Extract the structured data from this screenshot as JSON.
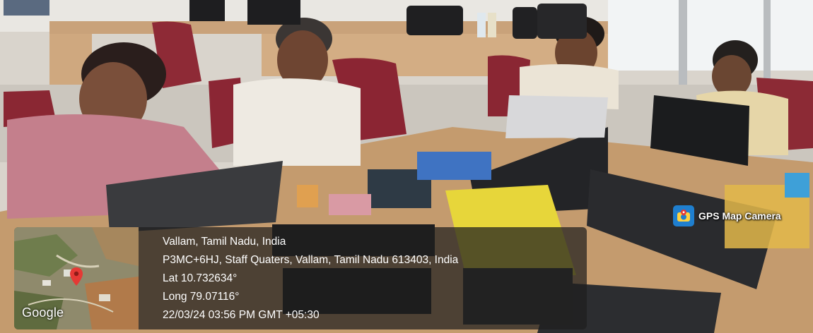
{
  "gps_camera": {
    "badge_label": "GPS Map Camera",
    "icon": "camera-pin-icon"
  },
  "location": {
    "place": "Vallam, Tamil Nadu, India",
    "address": "P3MC+6HJ, Staff Quaters, Vallam, Tamil Nadu 613403, India",
    "latitude": "Lat 10.732634°",
    "longitude": "Long 79.07116°",
    "timestamp": "22/03/24 03:56 PM GMT +05:30"
  },
  "map": {
    "attribution": "Google",
    "pin_color": "#e53935"
  },
  "colors": {
    "overlay": "#1e1e1e",
    "camera_badge": "#1f7fcf",
    "text": "#ffffff"
  }
}
